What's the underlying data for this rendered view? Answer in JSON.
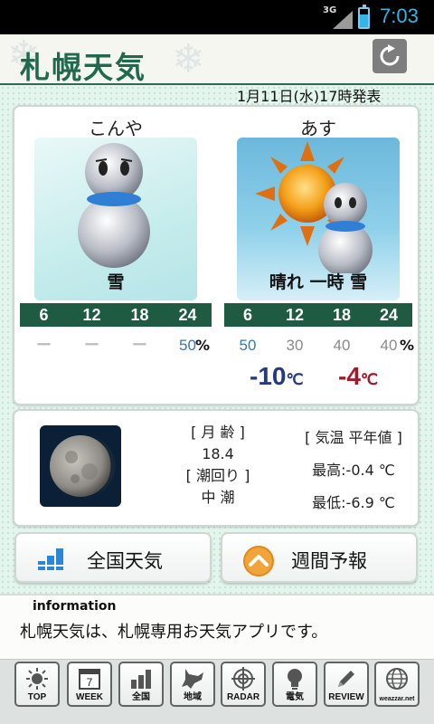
{
  "status_bar": {
    "network": "3G",
    "time": "7:03"
  },
  "header": {
    "title": "札幌天気",
    "refresh_icon": "refresh-icon"
  },
  "issued": "1月11日(水)17時発表",
  "forecast": {
    "today": {
      "label": "こんや",
      "weather": "雪",
      "hours": [
        "6",
        "12",
        "18",
        "24"
      ],
      "precip": [
        "ー",
        "ー",
        "ー",
        "50"
      ],
      "unit": "%"
    },
    "tomorrow": {
      "label": "あす",
      "weather": "晴れ 一時 雪",
      "hours": [
        "6",
        "12",
        "18",
        "24"
      ],
      "precip": [
        "50",
        "30",
        "40",
        "40"
      ],
      "unit": "%",
      "temp_min": "-10",
      "temp_max": "-4",
      "temp_unit": "℃"
    }
  },
  "moon": {
    "age_label": "[ 月 齢 ]",
    "age": "18.4",
    "tide_label": "[ 潮回り ]",
    "tide": "中 潮",
    "normal_label": "[ 気温 平年値 ]",
    "high": "最高:-0.4 ℃",
    "low": "最低:-6.9 ℃"
  },
  "buttons": {
    "national": "全国天気",
    "weekly": "週間予報"
  },
  "info": {
    "title": "information",
    "text": "札幌天気は、札幌専用お天気アプリです。"
  },
  "nav": [
    {
      "label": "TOP",
      "icon": "sun-icon"
    },
    {
      "label": "WEEK",
      "icon": "calendar-icon",
      "day": "7"
    },
    {
      "label": "全国",
      "icon": "bars-icon"
    },
    {
      "label": "地域",
      "icon": "hokkaido-icon"
    },
    {
      "label": "RADAR",
      "icon": "radar-icon"
    },
    {
      "label": "電気",
      "icon": "bulb-icon"
    },
    {
      "label": "REVIEW",
      "icon": "pencil-icon"
    },
    {
      "label": "weazzar.net",
      "icon": "globe-icon"
    }
  ],
  "colors": {
    "accent": "#1f5a43",
    "temp_min": "#243a82",
    "temp_max": "#a3192c",
    "status_time": "#33b5e5"
  }
}
